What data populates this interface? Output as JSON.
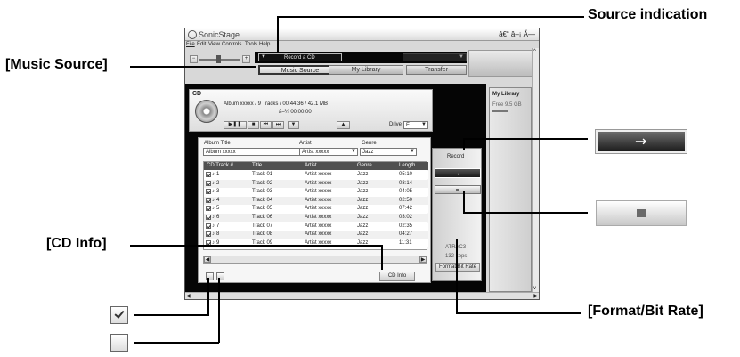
{
  "callouts": {
    "source_indication": "Source indication",
    "music_source": "[Music Source]",
    "cd_info": "[CD Info]",
    "format_bit_rate": "[Format/Bit Rate]"
  },
  "window": {
    "title": "SonicStage",
    "controls": "â€“ â–¡ Ã—",
    "menu": [
      "File",
      "Edit",
      "View",
      "Controls",
      "Tools",
      "Help"
    ],
    "source_value": "Record a CD",
    "tabs": [
      "Music Source",
      "My Library",
      "Transfer"
    ]
  },
  "cd": {
    "label": "CD",
    "summary": "Album xxxxx  /  9 Tracks  /  00:44:36  /  42.1  MB",
    "time": "â–¼ 00:00:00",
    "drive_label": "Drive",
    "drive_value": "E"
  },
  "fields": {
    "album_title_label": "Album Title",
    "album_title_value": "Album xxxxx",
    "artist_label": "Artist",
    "artist_value": "Artist xxxxx",
    "genre_label": "Genre",
    "genre_value": "Jazz"
  },
  "table": {
    "headers": [
      "CD Track #",
      "Title",
      "Artist",
      "Genre",
      "Length"
    ],
    "rows": [
      {
        "num": "1",
        "title": "Track 01",
        "artist": "Artist xxxxx",
        "genre": "Jazz",
        "length": "05:10",
        "checked": true
      },
      {
        "num": "2",
        "title": "Track 02",
        "artist": "Artist xxxxx",
        "genre": "Jazz",
        "length": "03:14",
        "checked": true
      },
      {
        "num": "3",
        "title": "Track 03",
        "artist": "Artist xxxxx",
        "genre": "Jazz",
        "length": "04:05",
        "checked": true
      },
      {
        "num": "4",
        "title": "Track 04",
        "artist": "Artist xxxxx",
        "genre": "Jazz",
        "length": "02:50",
        "checked": true
      },
      {
        "num": "5",
        "title": "Track 05",
        "artist": "Artist xxxxx",
        "genre": "Jazz",
        "length": "07:42",
        "checked": true
      },
      {
        "num": "6",
        "title": "Track 06",
        "artist": "Artist xxxxx",
        "genre": "Jazz",
        "length": "03:02",
        "checked": true
      },
      {
        "num": "7",
        "title": "Track 07",
        "artist": "Artist xxxxx",
        "genre": "Jazz",
        "length": "02:35",
        "checked": true
      },
      {
        "num": "8",
        "title": "Track 08",
        "artist": "Artist xxxxx",
        "genre": "Jazz",
        "length": "04:27",
        "checked": true
      },
      {
        "num": "9",
        "title": "Track 09",
        "artist": "Artist xxxxx",
        "genre": "Jazz",
        "length": "11:31",
        "checked": true
      }
    ],
    "cd_info_button": "CD Info"
  },
  "record_panel": {
    "record_label": "Record",
    "format": "ATRAC3",
    "bitrate": "132 kbps",
    "format_button": "Format/Bit Rate"
  },
  "library": {
    "title": "My Library",
    "free": "Free 9.5  GB"
  },
  "legend": {
    "checked": true,
    "unchecked": false
  }
}
